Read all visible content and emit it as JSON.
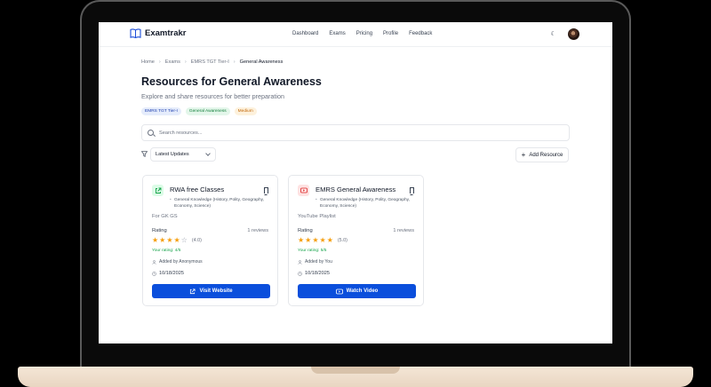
{
  "navbar": {
    "brand": "Examtrakr",
    "links": [
      "Dashboard",
      "Exams",
      "Pricing",
      "Profile",
      "Feedback"
    ]
  },
  "breadcrumb": [
    "Home",
    "Exams",
    "EMRS TGT Tier-I",
    "General Awareness"
  ],
  "page": {
    "title": "Resources for General Awareness",
    "subtitle": "Explore and share resources for better preparation",
    "tags": [
      "EMRS TGT Tier-I",
      "General Awareness",
      "Medium"
    ]
  },
  "search": {
    "placeholder": "Search resources..."
  },
  "filter": {
    "sort_value": "Latest Updates",
    "add_label": "Add Resource"
  },
  "cards": [
    {
      "title": "RWA free Classes",
      "category": "General Knowledge (History, Polity, Geography, Economy, Science)",
      "description": "For GK GS",
      "rating_label": "Rating",
      "reviews": "1 reviews",
      "stars": 4,
      "score": "(4.0)",
      "your_rating": "Your rating: 4/5",
      "added_by": "Added by Anonymous",
      "date": "10/18/2025",
      "button": "Visit Website",
      "icon": "external-link-icon"
    },
    {
      "title": "EMRS General Awareness",
      "category": "General Knowledge (History, Polity, Geography, Economy, Science)",
      "description": "YouTube Playlist",
      "rating_label": "Rating",
      "reviews": "1 reviews",
      "stars": 5,
      "score": "(5.0)",
      "your_rating": "Your rating: 5/5",
      "added_by": "Added by You",
      "date": "10/18/2025",
      "button": "Watch Video",
      "icon": "youtube-icon"
    }
  ],
  "colors": {
    "primary": "#0b4fdc",
    "star": "#f59e0b",
    "success": "#16a34a"
  }
}
